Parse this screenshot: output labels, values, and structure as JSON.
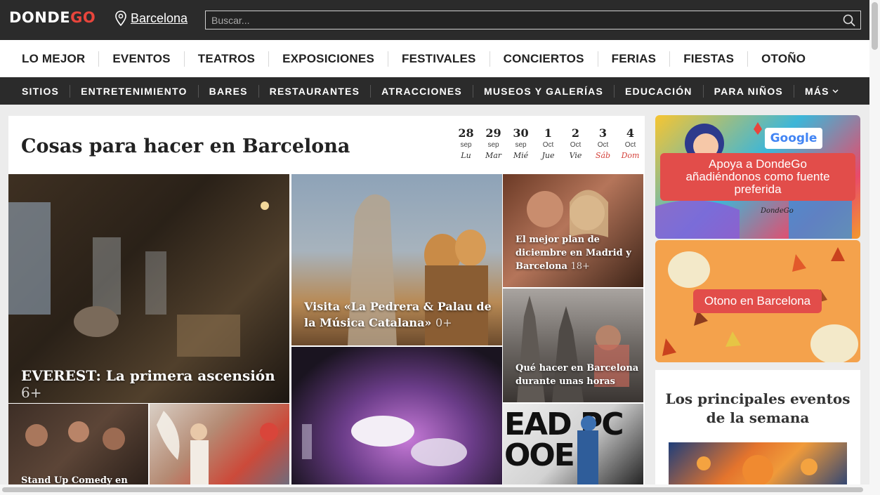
{
  "header": {
    "logo_text": "DONDEGO",
    "logo_accent": "GO",
    "logo_main": "DONDE",
    "city": "Barcelona",
    "search_placeholder": "Buscar...",
    "colors": {
      "bar": "#2b2b2b",
      "accent": "#e8453c"
    }
  },
  "nav_primary": [
    "LO MEJOR",
    "EVENTOS",
    "TEATROS",
    "EXPOSICIONES",
    "FESTIVALES",
    "CONCIERTOS",
    "FERIAS",
    "FIESTAS",
    "OTOÑO"
  ],
  "nav_secondary": [
    "SITIOS",
    "ENTRETENIMIENTO",
    "BARES",
    "RESTAURANTES",
    "ATRACCIONES",
    "MUSEOS Y GALERÍAS",
    "EDUCACIÓN",
    "PARA NIÑOS",
    "MÁS"
  ],
  "main": {
    "title": "Cosas para hacer en Barcelona",
    "calendar": [
      {
        "num": "28",
        "month": "sep",
        "weekday": "Lu",
        "weekend": false
      },
      {
        "num": "29",
        "month": "sep",
        "weekday": "Mar",
        "weekend": false
      },
      {
        "num": "30",
        "month": "sep",
        "weekday": "Mié",
        "weekend": false
      },
      {
        "num": "1",
        "month": "Oct",
        "weekday": "Jue",
        "weekend": false
      },
      {
        "num": "2",
        "month": "Oct",
        "weekday": "Vie",
        "weekend": false
      },
      {
        "num": "3",
        "month": "Oct",
        "weekday": "Sáb",
        "weekend": true
      },
      {
        "num": "4",
        "month": "Oct",
        "weekday": "Dom",
        "weekend": true
      }
    ],
    "tiles": [
      {
        "title": "EVEREST: La primera ascensión",
        "age": "6+"
      },
      {
        "title": "Visita «La Pedrera & Palau de la Música Catalana»",
        "age": "0+"
      },
      {
        "title": "El mejor plan de diciembre en Madrid y Barcelona",
        "age": "18+"
      },
      {
        "title": "Qué hacer en Barcelona durante unas horas",
        "age": ""
      },
      {
        "title": "Stand Up Comedy en",
        "age": ""
      },
      {
        "bigtext": "EAD PC\nOOE"
      }
    ]
  },
  "sidebar": {
    "promo1_brand": "Google",
    "promo1_text": "Apoya a DondeGo añadiéndonos como fuente preferida",
    "promo1_footer": "DondeGo",
    "promo2_text": "Otono en Barcelona",
    "events_title": "Los principales eventos de la semana"
  }
}
